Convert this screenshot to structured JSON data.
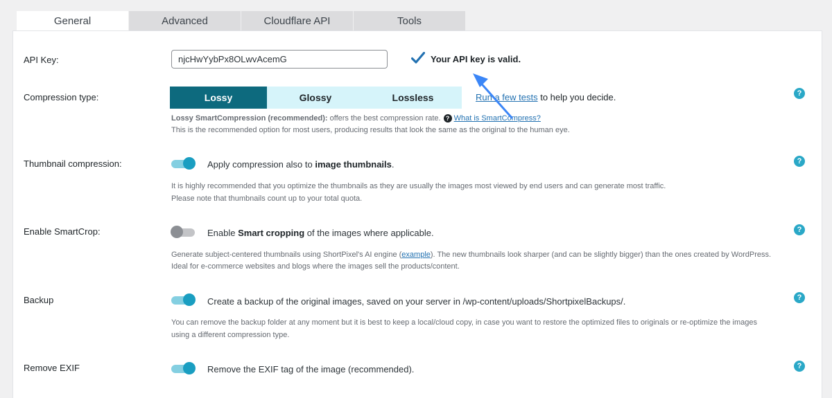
{
  "tabs": [
    {
      "label": "General"
    },
    {
      "label": "Advanced"
    },
    {
      "label": "Cloudflare API"
    },
    {
      "label": "Tools"
    }
  ],
  "api_key": {
    "label": "API Key:",
    "value": "njcHwYybPx8OLwvAcemG",
    "valid_text": "Your API key is valid."
  },
  "compression": {
    "label": "Compression type:",
    "options": [
      "Lossy",
      "Glossy",
      "Lossless"
    ],
    "selected": "Lossy",
    "tests_link": "Run a few tests",
    "tests_suffix": " to help you decide.",
    "desc_bold": "Lossy SmartCompression (recommended):",
    "desc_rest": " offers the best compression rate.",
    "what_is_link": "What is SmartCompress?",
    "desc_line2": "This is the recommended option for most users, producing results that look the same as the original to the human eye."
  },
  "thumbnail": {
    "label": "Thumbnail compression:",
    "toggle_on": true,
    "text_pre": "Apply compression also to ",
    "text_bold": "image thumbnails",
    "text_post": ".",
    "desc_line1": "It is highly recommended that you optimize the thumbnails as they are usually the images most viewed by end users and can generate most traffic.",
    "desc_line2": "Please note that thumbnails count up to your total quota."
  },
  "smartcrop": {
    "label": "Enable SmartCrop:",
    "toggle_on": false,
    "text_pre": "Enable ",
    "text_bold": "Smart cropping",
    "text_post": " of the images where applicable.",
    "desc_pre": "Generate subject-centered thumbnails using ShortPixel's AI engine (",
    "desc_link": "example",
    "desc_post": "). The new thumbnails look sharper (and can be slightly bigger) than the ones created by WordPress.",
    "desc_line2": "Ideal for e-commerce websites and blogs where the images sell the products/content."
  },
  "backup": {
    "label": "Backup",
    "toggle_on": true,
    "text": "Create a backup of the original images, saved on your server in /wp-content/uploads/ShortpixelBackups/.",
    "desc_line1": "You can remove the backup folder at any moment but it is best to keep a local/cloud copy, in case you want to restore the optimized files to originals or re-optimize the images",
    "desc_line2": "using a different compression type."
  },
  "exif": {
    "label": "Remove EXIF",
    "toggle_on": true,
    "text": "Remove the EXIF tag of the image (recommended)."
  },
  "help_glyph": "?",
  "colors": {
    "accent": "#0d6a7e",
    "toggle": "#1a9ec1",
    "help": "#2aa8c7",
    "arrow": "#3b86f7"
  }
}
